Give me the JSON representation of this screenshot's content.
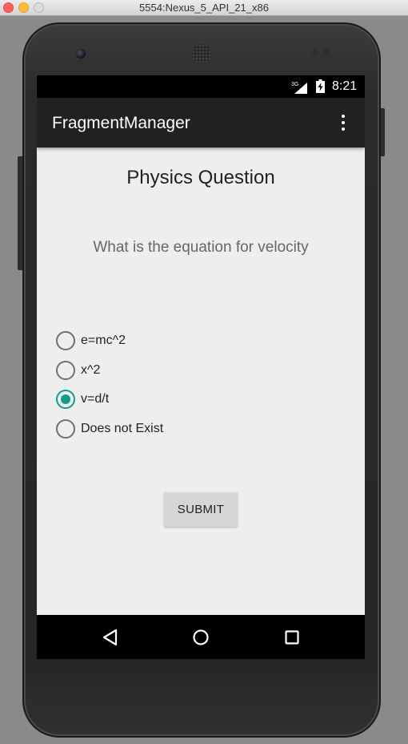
{
  "window": {
    "title": "5554:Nexus_5_API_21_x86"
  },
  "status_bar": {
    "network": "3G",
    "time": "8:21"
  },
  "app_bar": {
    "title": "FragmentManager",
    "overflow_icon": "more-vert-icon"
  },
  "content": {
    "heading": "Physics Question",
    "question": "What is the equation for velocity",
    "options": [
      {
        "label": "e=mc^2",
        "checked": false
      },
      {
        "label": "x^2",
        "checked": false
      },
      {
        "label": "v=d/t",
        "checked": true
      },
      {
        "label": "Does not Exist",
        "checked": false
      }
    ],
    "submit_label": "SUBMIT"
  },
  "nav_bar": {
    "back_icon": "back-triangle-icon",
    "home_icon": "home-circle-icon",
    "recents_icon": "recents-square-icon"
  },
  "colors": {
    "accent": "#129c8c",
    "app_bar": "#212121",
    "background": "#eeeeee"
  }
}
